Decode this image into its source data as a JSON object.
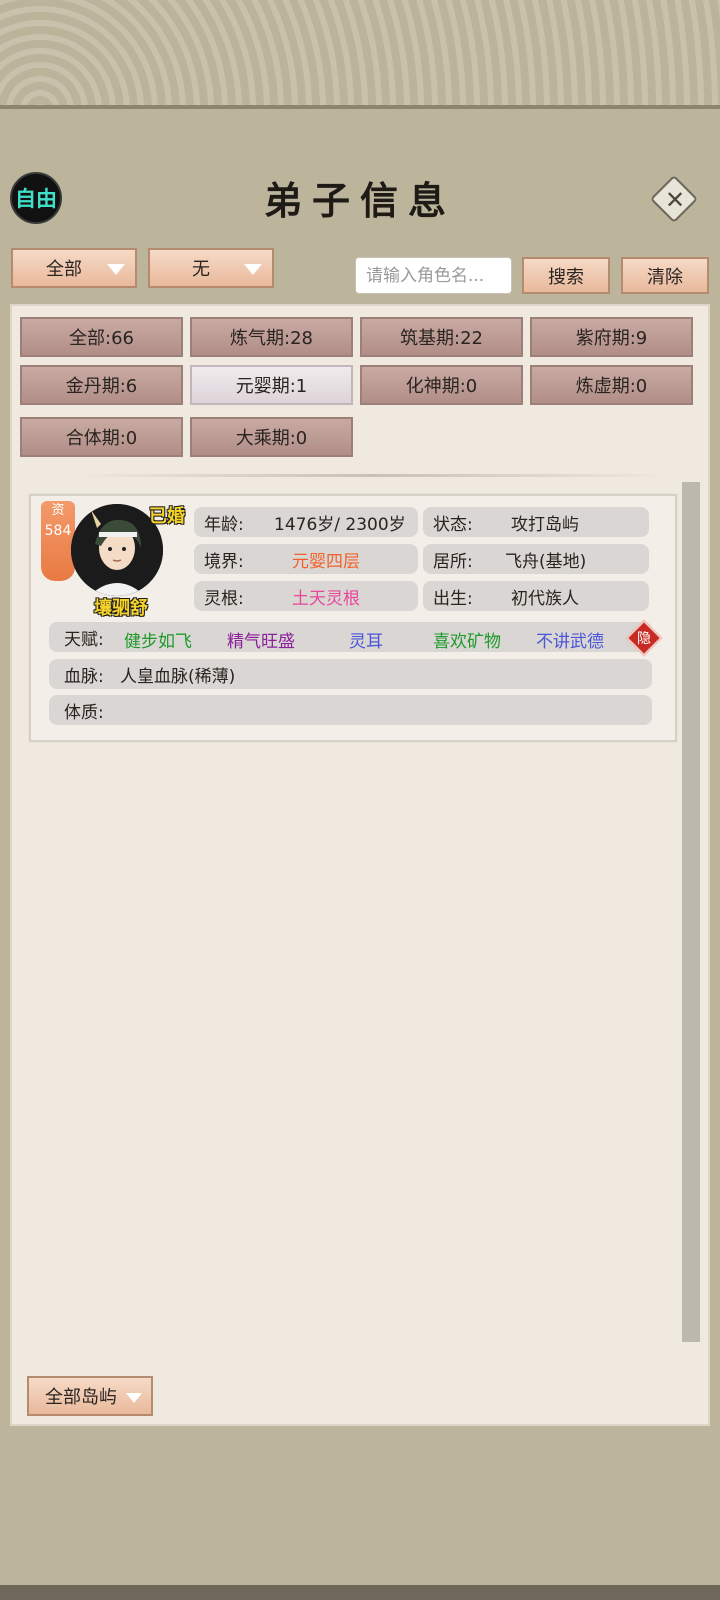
{
  "header": {
    "title": "弟子信息",
    "free_label": "自由"
  },
  "toolbar": {
    "realm_dropdown": "全部",
    "second_dropdown": "无",
    "search_placeholder": "请输入角色名...",
    "search_label": "搜索",
    "clear_label": "清除"
  },
  "filters": [
    {
      "label": "全部:66"
    },
    {
      "label": "炼气期:28"
    },
    {
      "label": "筑基期:22"
    },
    {
      "label": "紫府期:9"
    },
    {
      "label": "金丹期:6"
    },
    {
      "label": "元婴期:1",
      "selected": true
    },
    {
      "label": "化神期:0"
    },
    {
      "label": "炼虚期:0"
    },
    {
      "label": "合体期:0"
    },
    {
      "label": "大乘期:0"
    }
  ],
  "disciple": {
    "aptitude_label": "资",
    "aptitude_value": "584",
    "married": "已婚",
    "name": "壤驷舒",
    "age_label": "年龄:",
    "age_value": "1476岁/ 2300岁",
    "status_label": "状态:",
    "status_value": "攻打岛屿",
    "realm_label": "境界:",
    "realm_value": "元婴四层",
    "residence_label": "居所:",
    "residence_value": "飞舟(基地)",
    "root_label": "灵根:",
    "root_value": "土天灵根",
    "birth_label": "出生:",
    "birth_value": "初代族人",
    "talent_label": "天赋:",
    "talents": [
      "健步如飞",
      "精气旺盛",
      "灵耳",
      "喜欢矿物",
      "不讲武德"
    ],
    "hide_label": "隐",
    "bloodline_label": "血脉:",
    "bloodline_value": "人皇血脉(稀薄)",
    "physique_label": "体质:",
    "physique_value": ""
  },
  "island_dropdown": "全部岛屿",
  "colors": {
    "realm_value": "#f2612d",
    "root_value": "#e8479a",
    "talent_1": "#1e9a2c",
    "talent_2": "#8b1f9c",
    "talent_3": "#4a55d8",
    "talent_4": "#1e9a2c",
    "talent_5": "#4a55d8"
  }
}
